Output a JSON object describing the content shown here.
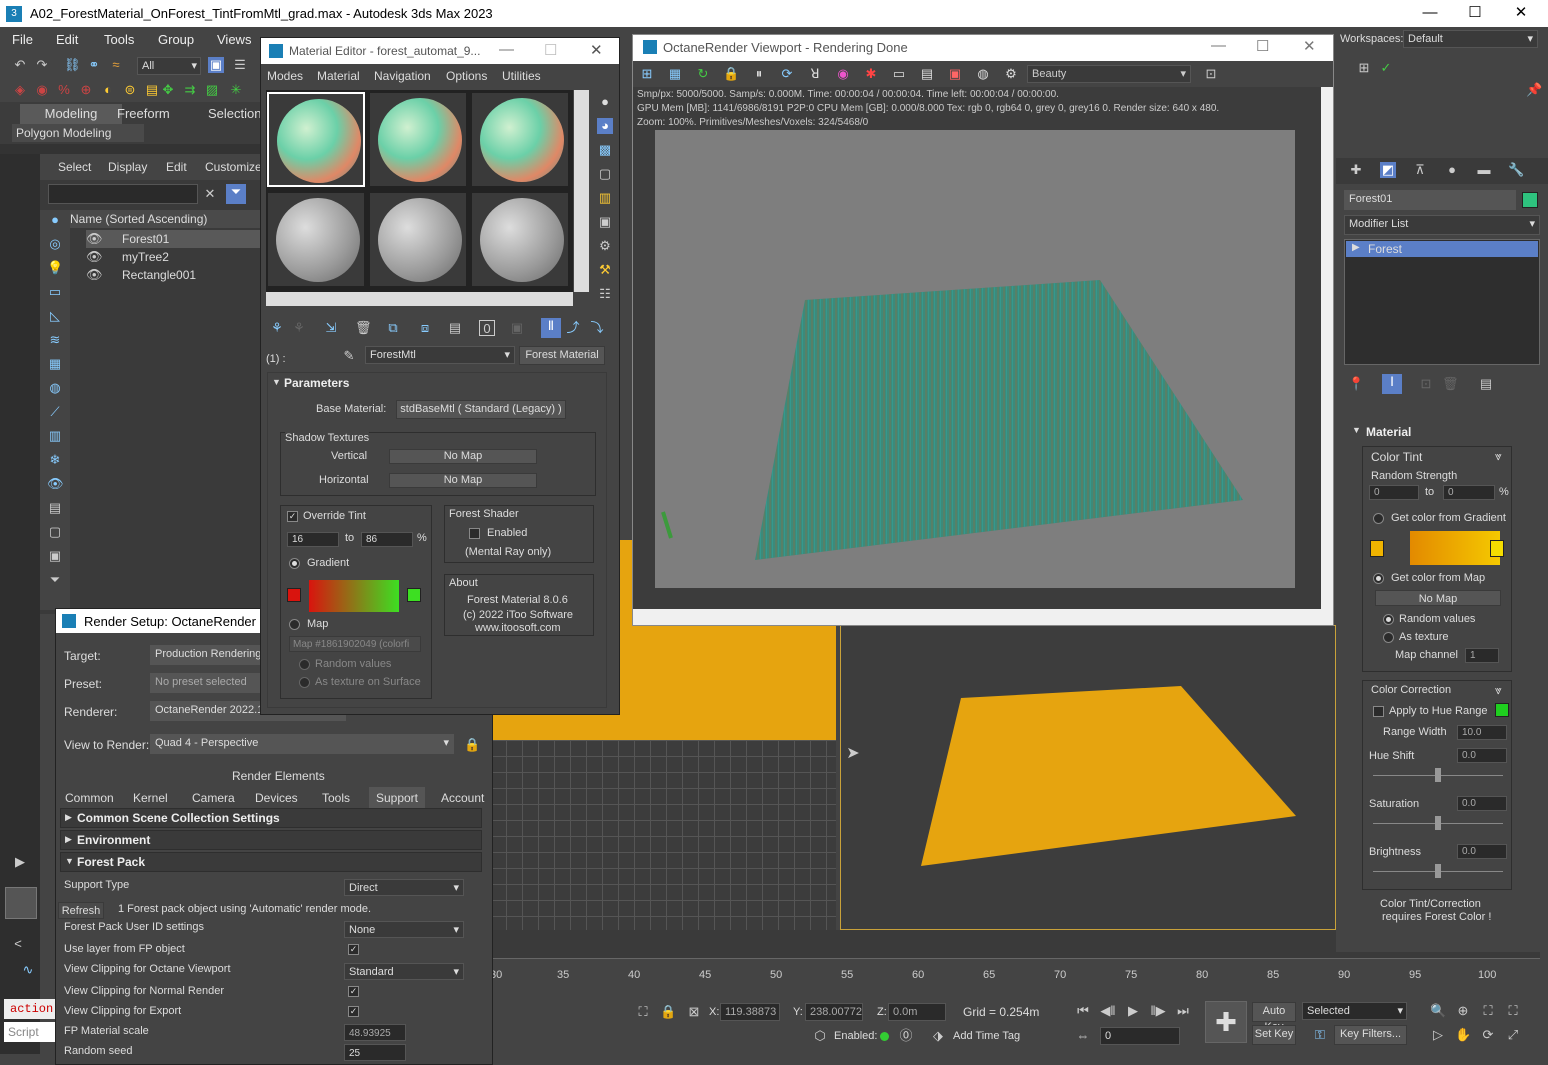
{
  "app": {
    "title": "A02_ForestMaterial_OnForest_TintFromMtl_grad.max - Autodesk 3ds Max 2023"
  },
  "menu": [
    "File",
    "Edit",
    "Tools",
    "Group",
    "Views"
  ],
  "toolbar": {
    "filter": "All",
    "ribbon_tabs": [
      "Modeling",
      "Freeform",
      "Selection"
    ],
    "ribbon_sub": "Polygon Modeling",
    "workspace_label": "Workspaces:",
    "workspace_value": "Default"
  },
  "scene_explorer": {
    "tabs": [
      "Select",
      "Display",
      "Edit",
      "Customize"
    ],
    "column": "Name (Sorted Ascending)",
    "items": [
      "Forest01",
      "myTree2",
      "Rectangle001"
    ]
  },
  "mat_editor": {
    "title": "Material Editor - forest_automat_9...",
    "menu": [
      "Modes",
      "Material",
      "Navigation",
      "Options",
      "Utilities"
    ],
    "slot_label": "(1) :",
    "mat_name": "ForestMtl",
    "mat_type": "Forest Material",
    "params_title": "Parameters",
    "base_label": "Base Material:",
    "base_value": "stdBaseMtl  ( Standard (Legacy) )",
    "shadow_title": "Shadow Textures",
    "vertical": "Vertical",
    "horizontal": "Horizontal",
    "no_map": "No Map",
    "override_tint": "Override Tint",
    "tint_from": "16",
    "tint_to_lbl": "to",
    "tint_to": "86",
    "pct": "%",
    "gradient": "Gradient",
    "map": "Map",
    "map_value": "Map #1861902049 (colorfi",
    "random_values": "Random values",
    "as_texture": "As texture on Surface",
    "forest_shader": "Forest Shader",
    "enabled": "Enabled",
    "mental_ray": "(Mental Ray only)",
    "about": "About",
    "about_l1": "Forest Material 8.0.6",
    "about_l2": "(c) 2022 iToo Software",
    "about_l3": "www.itoosoft.com"
  },
  "octane": {
    "title": "OctaneRender Viewport - Rendering Done",
    "pass": "Beauty",
    "stats1": "Smp/px: 5000/5000.   Samp/s: 0.000M.   Time: 00:00:04 / 00:00:04.   Time left: 00:00:04 / 00:00:00.",
    "stats2": "GPU Mem [MB]: 1141/6986/8191 P2P:0   CPU Mem [GB]: 0.000/8.000   Tex: rgb 0, rgb64 0, grey 0, grey16 0.   Render size: 640 x 480.",
    "stats3": "Zoom: 100%.   Primitives/Meshes/Voxels: 324/5468/0"
  },
  "render_setup": {
    "title": "Render Setup: OctaneRender 2022",
    "target_lbl": "Target:",
    "target": "Production Rendering",
    "preset_lbl": "Preset:",
    "preset": "No preset selected",
    "renderer_lbl": "Renderer:",
    "renderer": "OctaneRender 2022.1",
    "view_lbl": "View to Render:",
    "view": "Quad 4 - Perspective",
    "render_elements": "Render Elements",
    "tabs": [
      "Common",
      "Kernel",
      "Camera",
      "Devices",
      "Tools",
      "Support",
      "Account"
    ],
    "roll1": "Common Scene Collection Settings",
    "roll2": "Environment",
    "roll3": "Forest Pack",
    "support_type_lbl": "Support Type",
    "support_type": "Direct",
    "refresh": "Refresh",
    "refresh_msg": "1 Forest pack object using 'Automatic' render mode.",
    "uid_lbl": "Forest Pack User ID settings",
    "uid": "None",
    "layer_lbl": "Use layer from FP object",
    "clip_oct_lbl": "View Clipping for Octane Viewport",
    "clip_oct": "Standard",
    "clip_norm_lbl": "View Clipping for Normal Render",
    "clip_exp_lbl": "View Clipping for Export",
    "fp_scale_lbl": "FP Material scale",
    "fp_scale": "48.93925",
    "seed_lbl": "Random seed",
    "seed": "25"
  },
  "command": {
    "object": "Forest01",
    "modifier_list": "Modifier List",
    "stack_item": "Forest",
    "rollout": "Material",
    "color_tint": "Color Tint",
    "random_strength": "Random Strength",
    "rs_from": "0",
    "rs_to_lbl": "to",
    "rs_to": "0",
    "pct": "%",
    "from_gradient": "Get color from Gradient",
    "from_map": "Get color from Map",
    "no_map": "No Map",
    "random_values": "Random values",
    "as_texture": "As texture",
    "map_channel_lbl": "Map channel",
    "map_channel": "1",
    "color_correction": "Color Correction",
    "apply_hue": "Apply to Hue Range",
    "range_width_lbl": "Range Width",
    "range_width": "10.0",
    "hue_shift_lbl": "Hue Shift",
    "hue_shift": "0.0",
    "saturation_lbl": "Saturation",
    "saturation": "0.0",
    "brightness_lbl": "Brightness",
    "brightness": "0.0",
    "note1": "Color Tint/Correction",
    "note2": "requires Forest Color !"
  },
  "timeline": {
    "ticks": [
      "30",
      "35",
      "40",
      "45",
      "50",
      "55",
      "60",
      "65",
      "70",
      "75",
      "80",
      "85",
      "90",
      "95",
      "100"
    ]
  },
  "status": {
    "x_lbl": "X:",
    "x": "119.38873",
    "y_lbl": "Y:",
    "y": "238.00772",
    "z_lbl": "Z:",
    "z": "0.0m",
    "grid": "Grid = 0.254m",
    "enabled": "Enabled:",
    "add_time_tag": "Add Time Tag",
    "frame": "0",
    "autokey": "Auto Key",
    "selected": "Selected",
    "setkey": "Set Key",
    "keyfilters": "Key Filters...",
    "action": "action",
    "script": "Script"
  },
  "colors": {
    "accent": "#5b7fc7",
    "forest_orange": "#e6a40f",
    "gradient_red": "#d9140e",
    "gradient_green": "#3ddf22"
  }
}
